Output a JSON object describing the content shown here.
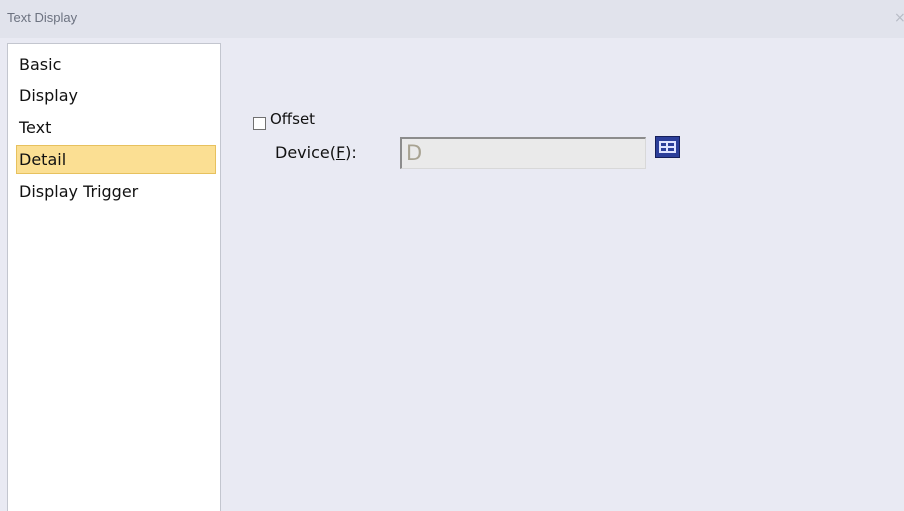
{
  "window": {
    "title": "Text Display",
    "close_glyph": "×"
  },
  "nav": {
    "items": [
      {
        "label": "Basic"
      },
      {
        "label": "Display"
      },
      {
        "label": "Text"
      },
      {
        "label": "Detail",
        "selected": true
      },
      {
        "label": "Display Trigger"
      }
    ]
  },
  "detail": {
    "offset_label": "Offset",
    "offset_checked": false,
    "device_label_prefix": "Device(",
    "device_label_mnemonic": "F",
    "device_label_suffix": "):",
    "device_value": "D",
    "device_button_icon": "device-list-icon"
  },
  "colors": {
    "selected_bg": "#fbdf93",
    "dialog_bg": "#e9eaf3",
    "icon_blue": "#2c3f9a"
  }
}
